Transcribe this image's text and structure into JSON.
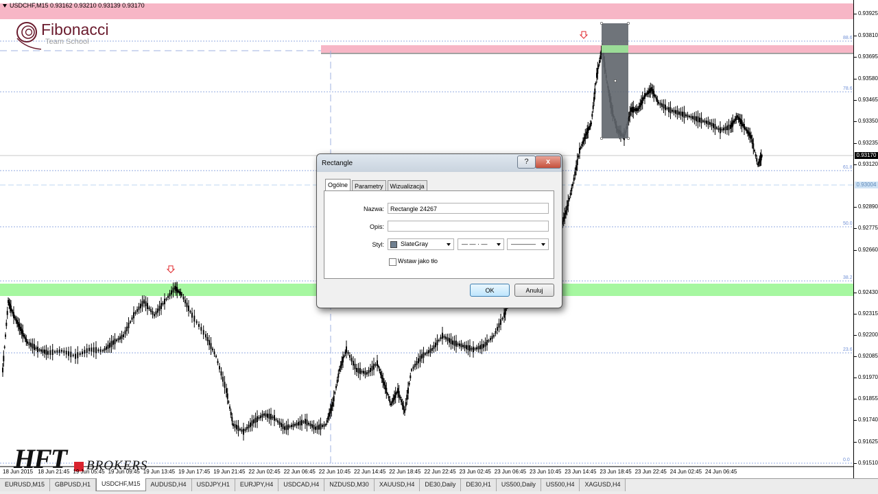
{
  "chart": {
    "symbol_line": "USDCHF,M15  0.93162 0.93210 0.93139 0.93170",
    "price_ticks": [
      "0.93925",
      "0.93810",
      "0.93695",
      "0.93580",
      "0.93465",
      "0.93350",
      "0.93235",
      "0.93120",
      "0.92890",
      "0.92775",
      "0.92660",
      "0.92430",
      "0.92315",
      "0.92200",
      "0.92085",
      "0.91970",
      "0.91855",
      "0.91740",
      "0.91625",
      "0.91510"
    ],
    "current_price": "0.93170",
    "secondary_price": "0.93004",
    "fib_levels": [
      "88.6",
      "78.6",
      "61.8",
      "50.0",
      "38.2",
      "23.6",
      "0.0"
    ],
    "time_labels": [
      "18 Jun 2015",
      "18 Jun 21:45",
      "19 Jun 05:45",
      "19 Jun 09:45",
      "19 Jun 13:45",
      "19 Jun 17:45",
      "19 Jun 21:45",
      "22 Jun 02:45",
      "22 Jun 06:45",
      "22 Jun 10:45",
      "22 Jun 14:45",
      "22 Jun 18:45",
      "22 Jun 22:45",
      "23 Jun 02:45",
      "23 Jun 06:45",
      "23 Jun 10:45",
      "23 Jun 14:45",
      "23 Jun 18:45",
      "23 Jun 22:45",
      "24 Jun 02:45",
      "24 Jun 06:45"
    ],
    "colors": {
      "pink_zone": "#f7b6c6",
      "green_zone": "#a6f7a0",
      "candle": "#000000",
      "fib_line": "#6f8fd6",
      "rect_fill": "#5f656b",
      "arrow": "#e0262a"
    }
  },
  "logos": {
    "fibonacci_name": "Fibonacci",
    "fibonacci_sub": "Team School",
    "hft_text": "HFT",
    "brokers_text": "BROKERS"
  },
  "tabs": [
    "EURUSD,M15",
    "GBPUSD,H1",
    "USDCHF,M15",
    "AUDUSD,H4",
    "USDJPY,H1",
    "EURJPY,H4",
    "USDCAD,H4",
    "NZDUSD,M30",
    "XAUUSD,H4",
    "DE30,Daily",
    "DE30,H1",
    "US500,Daily",
    "US500,H4",
    "XAGUSD,H4"
  ],
  "active_tab": "USDCHF,M15",
  "dialog": {
    "title": "Rectangle",
    "help_label": "?",
    "close_label": "x",
    "tabs": [
      "Ogólne",
      "Parametry",
      "Wizualizacja"
    ],
    "name_label": "Nazwa:",
    "name_value": "Rectangle 24267",
    "desc_label": "Opis:",
    "desc_value": "",
    "style_label": "Styl:",
    "color_value": "SlateGray",
    "line_style_value": "— — · —",
    "line_width_value": "————",
    "background_label": "Wstaw jako tło",
    "ok_label": "OK",
    "cancel_label": "Anuluj"
  }
}
